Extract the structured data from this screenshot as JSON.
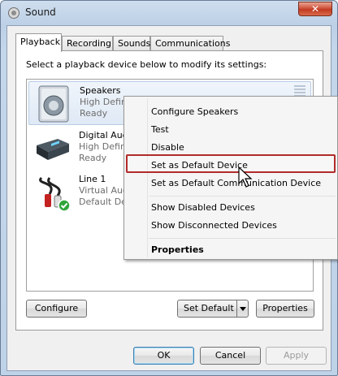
{
  "window": {
    "title": "Sound",
    "close_glyph": "✕"
  },
  "tabs": [
    "Playback",
    "Recording",
    "Sounds",
    "Communications"
  ],
  "instruction": "Select a playback device below to modify its settings:",
  "devices": [
    {
      "name": "Speakers",
      "line1": "High Definition Audio Device",
      "line2": "Ready",
      "icon": "speaker-icon"
    },
    {
      "name": "Digital Audio",
      "line1": "High Definition Audio Device",
      "line2": "Ready",
      "icon": "digital-audio-icon"
    },
    {
      "name": "Line 1",
      "line1": "Virtual Audio Cable",
      "line2": "Default Device",
      "icon": "rca-cable-icon"
    }
  ],
  "context_menu": {
    "items": [
      "Configure Speakers",
      "Test",
      "Disable",
      "Set as Default Device",
      "Set as Default Communication Device",
      "Show Disabled Devices",
      "Show Disconnected Devices",
      "Properties"
    ],
    "highlighted": "Set as Default Device"
  },
  "buttons": {
    "configure": "Configure",
    "set_default": "Set Default",
    "properties": "Properties",
    "ok": "OK",
    "cancel": "Cancel",
    "apply": "Apply"
  },
  "colors": {
    "highlight_outline": "#b12b2b",
    "default_check": "#2fa53a"
  }
}
